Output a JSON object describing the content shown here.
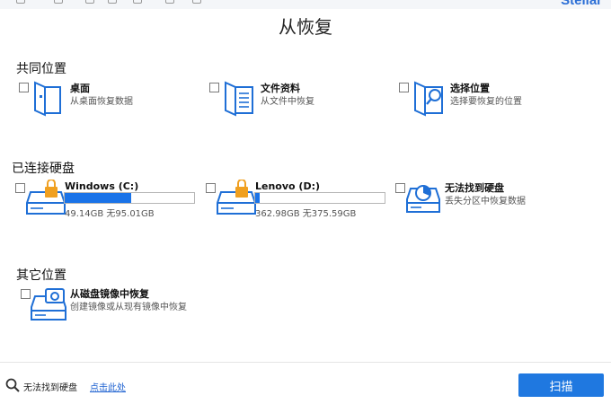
{
  "window": {
    "brand": "Stellar",
    "title": "从恢复"
  },
  "sections": {
    "common": "共同位置",
    "drives": "已连接硬盘",
    "other": "其它位置"
  },
  "common_locations": [
    {
      "label": "桌面",
      "sub": "从桌面恢复数据",
      "icon": "desktop-folder-icon"
    },
    {
      "label": "文件资料",
      "sub": "从文件中恢复",
      "icon": "documents-folder-icon"
    },
    {
      "label": "选择位置",
      "sub": "选择要恢复的位置",
      "icon": "folder-search-icon"
    }
  ],
  "drives": [
    {
      "label": "Windows (C:)",
      "usage": "49.14GB 无95.01GB",
      "used_fraction": 0.517,
      "icon": "locked-drive-icon"
    },
    {
      "label": "Lenovo (D:)",
      "usage": "362.98GB 无375.59GB",
      "used_fraction": 0.034,
      "icon": "locked-drive-icon"
    },
    {
      "label": "无法找到硬盘",
      "sub": "丢失分区中恢复数据",
      "icon": "partition-drive-icon"
    }
  ],
  "other_locations": [
    {
      "label": "从磁盘镜像中恢复",
      "sub": "创建镜像或从现有镜像中恢复",
      "icon": "disk-image-icon"
    }
  ],
  "footer": {
    "text": "无法找到硬盘",
    "link": "点击此处",
    "scan": "扫描"
  },
  "colors": {
    "accent": "#1f78e0",
    "bar_fill": "#1a73e8",
    "lock": "#f0a020"
  }
}
